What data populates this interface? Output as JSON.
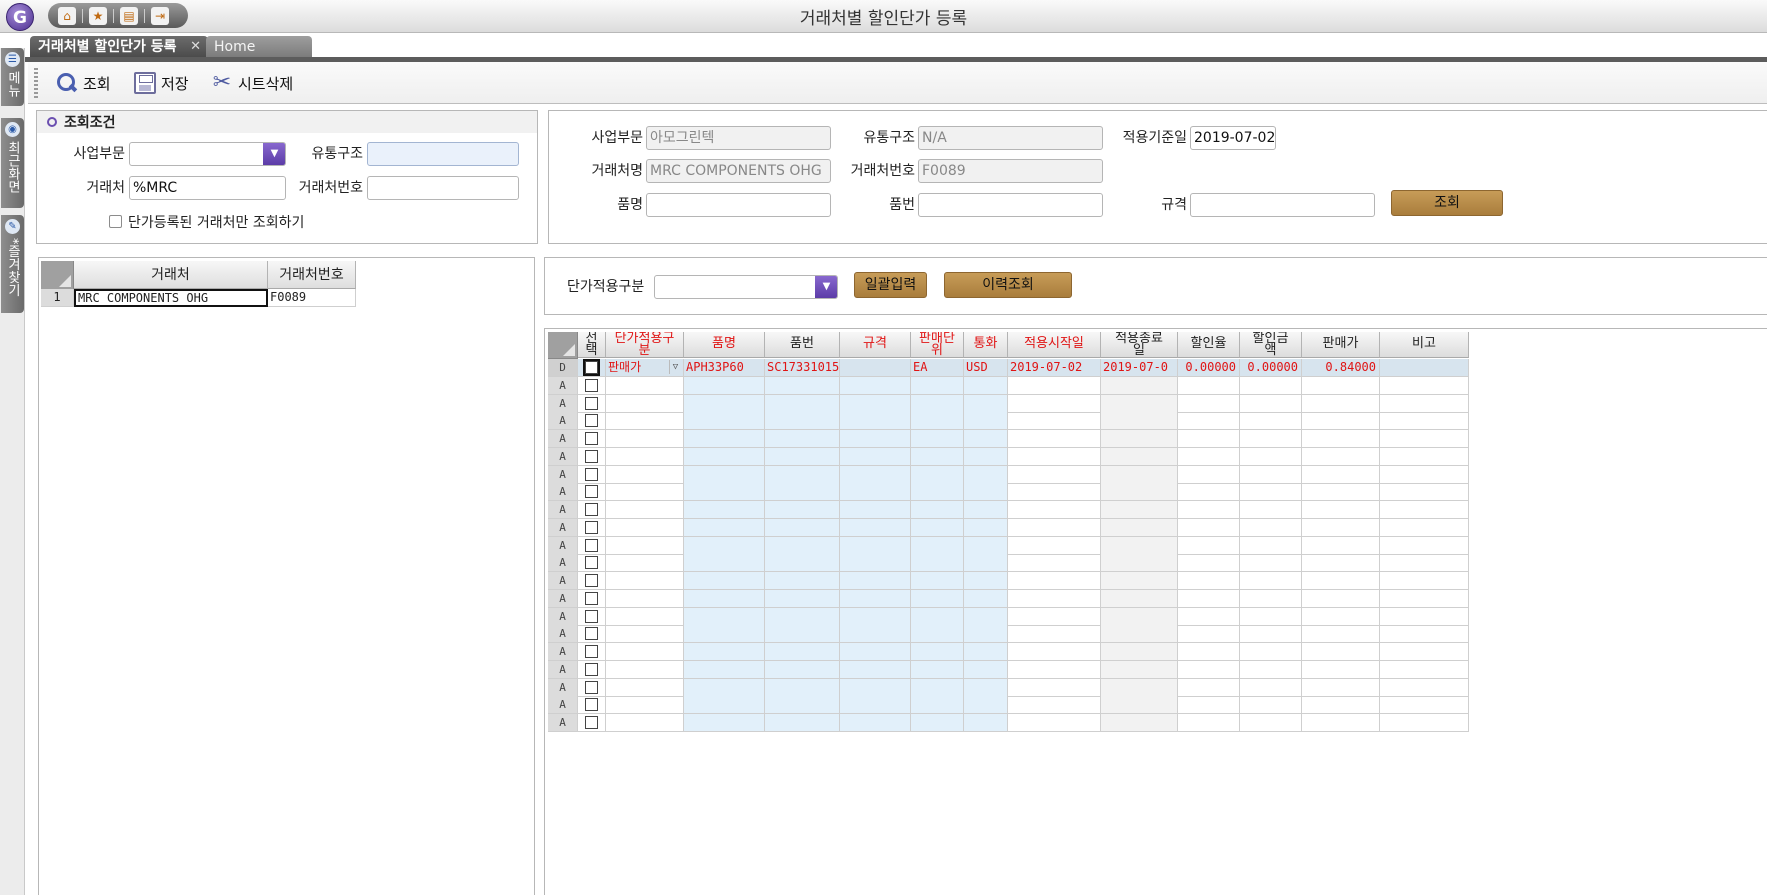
{
  "window": {
    "title": "거래처별 할인단가 등록",
    "logo_letter": "G"
  },
  "side_tabs": [
    {
      "label": "메뉴"
    },
    {
      "label": "최근화면"
    },
    {
      "label": "*즐겨찾기"
    }
  ],
  "doc_tabs": {
    "active": "거래처별 할인단가 등록",
    "close_glyph": "✕",
    "home": "Home"
  },
  "toolbar": {
    "search_label": "조회",
    "save_label": "저장",
    "delete_sheet_label": "시트삭제"
  },
  "search_conditions": {
    "title": "조회조건",
    "business_unit_label": "사업부문",
    "business_unit_value": "",
    "distribution_label": "유통구조",
    "distribution_value": "",
    "customer_label": "거래처",
    "customer_value": "%MRC",
    "customer_no_label": "거래처번호",
    "customer_no_value": "",
    "registered_only_label": "단가등록된 거래처만 조회하기"
  },
  "filter": {
    "business_unit_label": "사업부문",
    "business_unit_value": "아모그린텍",
    "distribution_label": "유통구조",
    "distribution_value": "N/A",
    "base_date_label": "적용기준일",
    "base_date_value": "2019-07-02",
    "customer_name_label": "거래처명",
    "customer_name_value": "MRC COMPONENTS OHG",
    "customer_no_label": "거래처번호",
    "customer_no_value": "F0089",
    "item_name_label": "품명",
    "item_name_value": "",
    "item_no_label": "품번",
    "item_no_value": "",
    "spec_label": "규격",
    "spec_value": "",
    "search_button": "조회"
  },
  "customer_grid": {
    "columns": [
      "거래처",
      "거래처번호"
    ],
    "rows": [
      {
        "num": "1",
        "name": "MRC COMPONENTS OHG",
        "code": "F0089"
      }
    ]
  },
  "options": {
    "price_type_label": "단가적용구분",
    "price_type_value": "",
    "bulk_input_button": "일괄입력",
    "history_button": "이력조회"
  },
  "price_grid": {
    "columns": [
      {
        "label": "선택",
        "wrap": "선\n택"
      },
      {
        "label": "단가적용구분",
        "wrap": "단가적용구\n분"
      },
      {
        "label": "품명"
      },
      {
        "label": "품번"
      },
      {
        "label": "규격"
      },
      {
        "label": "판매단위",
        "wrap": "판매단\n위"
      },
      {
        "label": "통화"
      },
      {
        "label": "적용시작일"
      },
      {
        "label": "적용종료일",
        "wrap": "적용종료\n일"
      },
      {
        "label": "할인율"
      },
      {
        "label": "할인금액",
        "wrap": "할인금\n액"
      },
      {
        "label": "판매가"
      },
      {
        "label": "비고"
      }
    ],
    "first_row": {
      "status": "D",
      "price_type": "판매가",
      "item_name": "APH33P60",
      "item_no": "SC17331015",
      "spec": "",
      "unit": "EA",
      "currency": "USD",
      "start_date": "2019-07-02",
      "end_date": "2019-07-0",
      "discount_rate": "0.00000",
      "discount_amount": "0.00000",
      "sale_price": "0.84000",
      "remark": ""
    },
    "blank_row_status": "A",
    "blank_row_count": 20
  }
}
